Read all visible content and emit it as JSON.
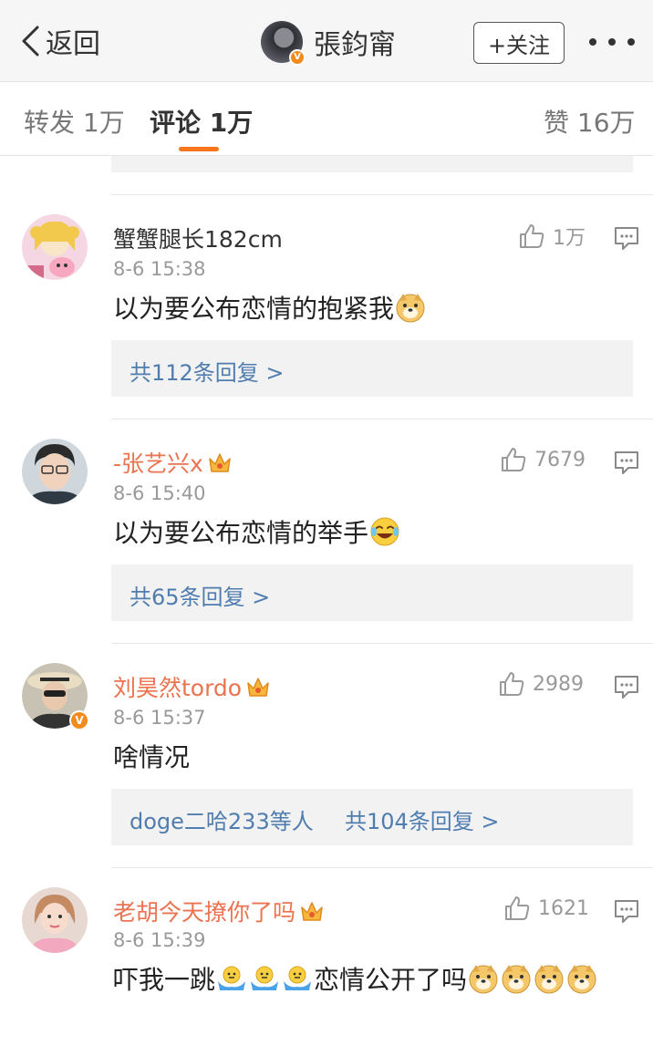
{
  "navbar": {
    "back_label": "返回",
    "user_name": "張鈞甯",
    "verified_badge": "V",
    "follow_label": "+关注"
  },
  "tabs": {
    "repost": "转发 1万",
    "comment": "评论 1万",
    "likes": "赞 16万"
  },
  "comments": [
    {
      "name": "蟹蟹腿长182cm",
      "time": "8-6 15:38",
      "text": "以为要公布恋情的抱紧我",
      "emojis": [
        "doge"
      ],
      "likes": "1万",
      "reply_summary": "共112条回复 >",
      "reply_users": ""
    },
    {
      "name": "-张艺兴x",
      "time": "8-6 15:40",
      "text": "以为要公布恋情的举手",
      "emojis": [
        "laugh-cry"
      ],
      "likes": "7679",
      "reply_summary": "共65条回复 >",
      "reply_users": ""
    },
    {
      "name": "刘昊然tordo",
      "time": "8-6 15:37",
      "text": "啥情况",
      "emojis": [],
      "likes": "2989",
      "reply_summary": "共104条回复 >",
      "reply_users": "doge二哈233等人"
    },
    {
      "name": "老胡今天撩你了吗",
      "time": "8-6 15:39",
      "text_before": "吓我一跳",
      "text_after": "恋情公开了吗",
      "emojis": [
        "shrug",
        "shrug",
        "shrug",
        "doge",
        "doge",
        "doge",
        "doge"
      ],
      "likes": "1621"
    }
  ],
  "colors": {
    "accent_orange": "#f7761b",
    "vip_name": "#eb7350",
    "link_blue": "#507daf"
  }
}
